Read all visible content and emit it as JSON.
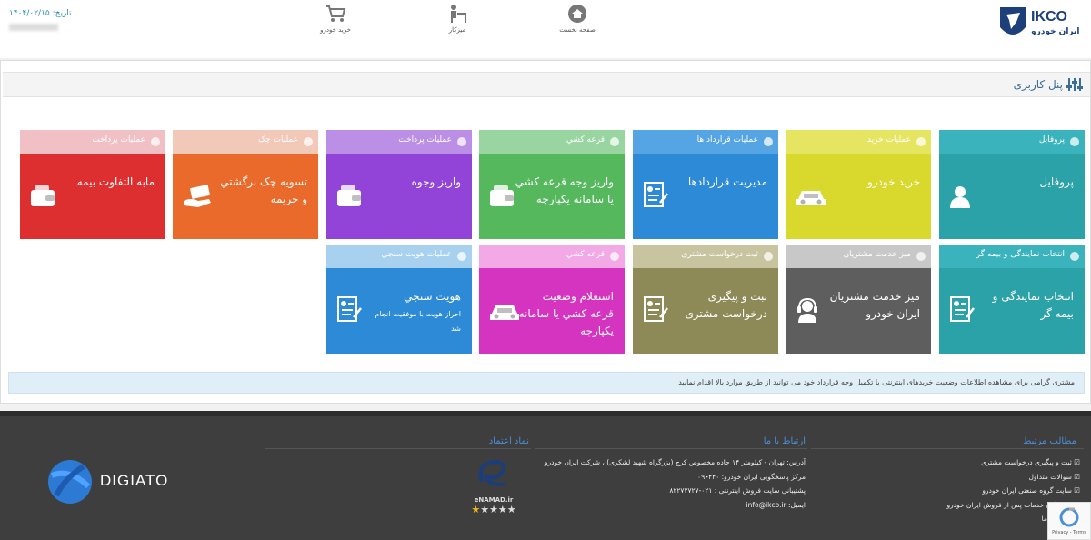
{
  "header": {
    "brand_text": "IKCO",
    "brand_sub": "ایران خودرو",
    "nav": [
      {
        "label": "صفحه نخست",
        "icon": "home-icon"
      },
      {
        "label": "میزکار",
        "icon": "desk-icon"
      },
      {
        "label": "خرید خودرو",
        "icon": "cart-icon"
      }
    ],
    "date_label": "تاریخ: ۱۴۰۴/۰۲/۱۵"
  },
  "panel": {
    "title": "پنل کاربری"
  },
  "tiles_row1": [
    {
      "head": "پروفایل",
      "title": "پروفایل",
      "sub": "",
      "head_color": "#3bb3bd",
      "body_color": "#2ba1a8",
      "icon": "user-icon"
    },
    {
      "head": "عملیات خرید",
      "title": "خرید خودرو",
      "sub": "",
      "head_color": "#e6e561",
      "body_color": "#d9d82c",
      "icon": "car-icon"
    },
    {
      "head": "عملیات قرارداد ها",
      "title": "مدیریت قراردادها",
      "sub": "",
      "head_color": "#55a4e4",
      "body_color": "#2d8ad7",
      "icon": "document-icon"
    },
    {
      "head": "قرعه کشي",
      "title": "واریز وجه قرعه کشي\nيا سامانه يکپارچه",
      "sub": "",
      "head_color": "#98d5a0",
      "body_color": "#55b85d",
      "icon": "wallet-icon"
    },
    {
      "head": "عملیات پرداخت",
      "title": "واریز وجوه",
      "sub": "",
      "head_color": "#bb8fe6",
      "body_color": "#9244d8",
      "icon": "wallet-icon"
    },
    {
      "head": "عملیات چک",
      "title": "تسویه چک برگشتي\nو جریمه",
      "sub": "",
      "head_color": "#f2c8b8",
      "body_color": "#ea6a2b",
      "icon": "cash-hand-icon"
    },
    {
      "head": "عملیات پرداخت",
      "title": "مابه التفاوت بیمه",
      "sub": "",
      "head_color": "#f0c0c4",
      "body_color": "#dd2f2f",
      "icon": "wallet-icon"
    }
  ],
  "tiles_row2": [
    {
      "head": "انتخاب نمایندگی و بیمه گر",
      "title": "انتخاب نمایندگی و\nبیمه گر",
      "sub": "",
      "head_color": "#3bb3bd",
      "body_color": "#2ba1a8",
      "icon": "document-icon"
    },
    {
      "head": "میز خدمت مشتریان",
      "title": "میز خدمت مشتریان\nایران خودرو",
      "sub": "",
      "head_color": "#c8c8c8",
      "body_color": "#5e5e5e",
      "icon": "headset-icon"
    },
    {
      "head": "ثبت درخواست مشتری",
      "title": "ثبت و پیگیری\nدرخواست مشتری",
      "sub": "",
      "head_color": "#c9c4a0",
      "body_color": "#8e8a57",
      "icon": "document-icon"
    },
    {
      "head": "قرعه کشي",
      "title": "استعلام وضعیت\nقرعه کشي يا سامانه\nيکپارچه",
      "sub": "",
      "head_color": "#f2a9e6",
      "body_color": "#d534c0",
      "icon": "car-icon"
    },
    {
      "head": "عملیات هویت سنجي",
      "title": "هویت سنجي",
      "sub": "احراز هویت با موفقیت انجام\nشد",
      "head_color": "#a8d1f0",
      "body_color": "#2d8ad7",
      "icon": "document-icon"
    }
  ],
  "notice": "مشتری گرامی برای مشاهده اطلاعات وضعیت خریدهای اینترنتی یا تکمیل وجه قرارداد خود می توانید از طریق موارد بالا اقدام نمایید",
  "footer": {
    "col_links_title": "مطالب مرتبط",
    "links": [
      "ثبت و پیگیری درخواست مشتری",
      "سوالات متداول",
      "سایت گروه صنعتی ایران خودرو",
      "نمایندگان خدمات پس از فروش ایران خودرو",
      "تماس با ما"
    ],
    "col_contact_title": "ارتباط با ما",
    "contact": [
      "آدرس: تهران - کیلومتر ۱۴ جاده مخصوص کرج (بزرگراه شهید لشکری) ، شرکت ایران خودرو",
      "مرکز پاسخگویی ایران خودرو: ۰۹۶۴۴۰",
      "پشتیبانی سایت فروش اینترنتی : ۰۲۱-۸۲۲۷۲۷۲۷",
      "ایمیل: info@ikco.ir"
    ],
    "col_trust_title": "نماد اعتماد",
    "enamad_text": "eNAMAD.ir",
    "digiato_text": "DIGIATO",
    "recaptcha_text": "Privacy - Terms"
  }
}
